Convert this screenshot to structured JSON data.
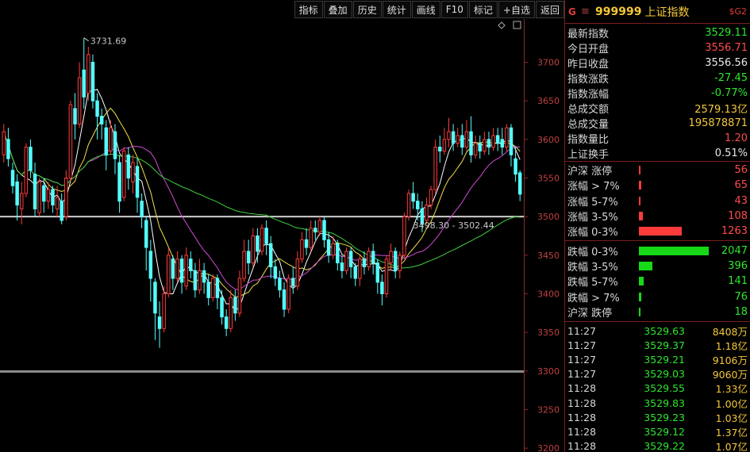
{
  "toolbar": {
    "buttons": [
      "指标",
      "叠加",
      "历史",
      "统计",
      "画线",
      "F10",
      "标记",
      "+自选",
      "返回"
    ]
  },
  "colors": {
    "up": "#ff3b3b",
    "down": "#54ffff",
    "ma5": "#ffffff",
    "ma10": "#f3e04a",
    "ma20": "#d14ad6",
    "ma60": "#3ecf3e",
    "bar_up": "#ff3b3b",
    "bar_down": "#16d816"
  },
  "panel": {
    "logo": "G",
    "menu_icon": "≡",
    "code": "999999",
    "name": "上证指数",
    "tag": "$G2",
    "stats": [
      {
        "label": "最新指数",
        "value": "3529.11",
        "color": "green"
      },
      {
        "label": "今日开盘",
        "value": "3556.71",
        "color": "red"
      },
      {
        "label": "昨日收盘",
        "value": "3556.56",
        "color": "white"
      },
      {
        "label": "指数涨跌",
        "value": "-27.45",
        "color": "green"
      },
      {
        "label": "指数涨幅",
        "value": "-0.77%",
        "color": "green"
      },
      {
        "label": "总成交额",
        "value": "2579.13亿",
        "color": "yellow"
      },
      {
        "label": "总成交量",
        "value": "195878871",
        "color": "yellow"
      },
      {
        "label": "指数量比",
        "value": "1.20",
        "color": "red"
      },
      {
        "label": "上证换手",
        "value": "0.51%",
        "color": "white"
      }
    ],
    "breadth_up": [
      {
        "label": "沪深 涨停",
        "value": "56"
      },
      {
        "label": "涨幅 > 7%",
        "value": "65"
      },
      {
        "label": "涨幅 5-7%",
        "value": "43"
      },
      {
        "label": "涨幅 3-5%",
        "value": "108"
      },
      {
        "label": "涨幅 0-3%",
        "value": "1263"
      }
    ],
    "breadth_down": [
      {
        "label": "跌幅 0-3%",
        "value": "2047"
      },
      {
        "label": "跌幅 3-5%",
        "value": "396"
      },
      {
        "label": "跌幅 5-7%",
        "value": "141"
      },
      {
        "label": "跌幅 > 7%",
        "value": "76"
      },
      {
        "label": "沪深 跌停",
        "value": "18"
      }
    ],
    "ticks": [
      {
        "time": "11:27",
        "price": "3529.63",
        "vol": "8408万"
      },
      {
        "time": "11:27",
        "price": "3529.37",
        "vol": "1.18亿"
      },
      {
        "time": "11:27",
        "price": "3529.21",
        "vol": "9106万"
      },
      {
        "time": "11:27",
        "price": "3529.03",
        "vol": "9060万"
      },
      {
        "time": "11:28",
        "price": "3529.55",
        "vol": "1.33亿"
      },
      {
        "time": "11:28",
        "price": "3529.83",
        "vol": "1.00亿"
      },
      {
        "time": "11:28",
        "price": "3529.23",
        "vol": "1.03亿"
      },
      {
        "time": "11:28",
        "price": "3529.12",
        "vol": "1.37亿"
      },
      {
        "time": "11:28",
        "price": "3529.22",
        "vol": "1.07亿"
      }
    ]
  },
  "chart_data": {
    "type": "candlestick",
    "y_ticks": [
      3200,
      3250,
      3300,
      3350,
      3400,
      3450,
      3500,
      3550,
      3600,
      3650,
      3700
    ],
    "ylim": [
      3195,
      3756
    ],
    "high_label": "3731.69",
    "cursor_label": "3498.30 - 3502.44",
    "cursor_value": 3500,
    "candles": [
      [
        3580,
        3610,
        3570,
        3620
      ],
      [
        3600,
        3575,
        3565,
        3615
      ],
      [
        3560,
        3540,
        3530,
        3570
      ],
      [
        3545,
        3515,
        3495,
        3555
      ],
      [
        3510,
        3530,
        3490,
        3545
      ],
      [
        3530,
        3590,
        3525,
        3595
      ],
      [
        3590,
        3560,
        3550,
        3600
      ],
      [
        3555,
        3510,
        3500,
        3570
      ],
      [
        3505,
        3545,
        3500,
        3550
      ],
      [
        3540,
        3520,
        3505,
        3550
      ],
      [
        3520,
        3535,
        3510,
        3545
      ],
      [
        3535,
        3515,
        3505,
        3540
      ],
      [
        3510,
        3525,
        3500,
        3540
      ],
      [
        3520,
        3495,
        3490,
        3530
      ],
      [
        3500,
        3550,
        3495,
        3560
      ],
      [
        3550,
        3645,
        3545,
        3650
      ],
      [
        3640,
        3620,
        3600,
        3660
      ],
      [
        3620,
        3680,
        3615,
        3700
      ],
      [
        3690,
        3655,
        3640,
        3731.69
      ],
      [
        3660,
        3710,
        3650,
        3720
      ],
      [
        3700,
        3650,
        3640,
        3710
      ],
      [
        3650,
        3630,
        3600,
        3660
      ],
      [
        3630,
        3620,
        3600,
        3640
      ],
      [
        3615,
        3580,
        3560,
        3625
      ],
      [
        3585,
        3615,
        3580,
        3625
      ],
      [
        3610,
        3575,
        3555,
        3620
      ],
      [
        3570,
        3520,
        3505,
        3580
      ],
      [
        3525,
        3585,
        3520,
        3590
      ],
      [
        3580,
        3550,
        3535,
        3590
      ],
      [
        3545,
        3570,
        3530,
        3580
      ],
      [
        3565,
        3525,
        3505,
        3575
      ],
      [
        3520,
        3500,
        3485,
        3530
      ],
      [
        3495,
        3460,
        3430,
        3500
      ],
      [
        3455,
        3420,
        3390,
        3470
      ],
      [
        3415,
        3375,
        3340,
        3420
      ],
      [
        3370,
        3355,
        3330,
        3390
      ],
      [
        3355,
        3400,
        3350,
        3410
      ],
      [
        3400,
        3450,
        3395,
        3460
      ],
      [
        3445,
        3420,
        3405,
        3450
      ],
      [
        3420,
        3445,
        3415,
        3455
      ],
      [
        3445,
        3415,
        3400,
        3450
      ],
      [
        3410,
        3450,
        3405,
        3460
      ],
      [
        3445,
        3430,
        3420,
        3455
      ],
      [
        3430,
        3405,
        3395,
        3440
      ],
      [
        3405,
        3430,
        3400,
        3445
      ],
      [
        3430,
        3415,
        3400,
        3440
      ],
      [
        3415,
        3395,
        3385,
        3425
      ],
      [
        3395,
        3420,
        3390,
        3425
      ],
      [
        3420,
        3395,
        3380,
        3425
      ],
      [
        3395,
        3370,
        3360,
        3405
      ],
      [
        3370,
        3355,
        3345,
        3380
      ],
      [
        3355,
        3395,
        3350,
        3405
      ],
      [
        3395,
        3375,
        3365,
        3405
      ],
      [
        3375,
        3420,
        3370,
        3430
      ],
      [
        3420,
        3455,
        3415,
        3470
      ],
      [
        3455,
        3440,
        3425,
        3470
      ],
      [
        3440,
        3475,
        3435,
        3485
      ],
      [
        3475,
        3455,
        3440,
        3485
      ],
      [
        3455,
        3485,
        3450,
        3490
      ],
      [
        3485,
        3465,
        3450,
        3495
      ],
      [
        3465,
        3435,
        3420,
        3475
      ],
      [
        3435,
        3420,
        3410,
        3445
      ],
      [
        3420,
        3405,
        3395,
        3430
      ],
      [
        3405,
        3380,
        3370,
        3415
      ],
      [
        3380,
        3420,
        3375,
        3425
      ],
      [
        3420,
        3410,
        3400,
        3435
      ],
      [
        3410,
        3445,
        3405,
        3455
      ],
      [
        3445,
        3470,
        3440,
        3480
      ],
      [
        3470,
        3460,
        3450,
        3485
      ],
      [
        3460,
        3485,
        3455,
        3495
      ],
      [
        3485,
        3480,
        3470,
        3495
      ],
      [
        3480,
        3495,
        3475,
        3500
      ],
      [
        3495,
        3470,
        3460,
        3500
      ],
      [
        3470,
        3450,
        3440,
        3480
      ],
      [
        3450,
        3465,
        3445,
        3475
      ],
      [
        3465,
        3440,
        3430,
        3470
      ],
      [
        3440,
        3430,
        3420,
        3450
      ],
      [
        3430,
        3455,
        3425,
        3460
      ],
      [
        3455,
        3435,
        3420,
        3460
      ],
      [
        3435,
        3420,
        3410,
        3440
      ],
      [
        3420,
        3445,
        3410,
        3450
      ],
      [
        3445,
        3435,
        3425,
        3455
      ],
      [
        3435,
        3455,
        3430,
        3460
      ],
      [
        3455,
        3440,
        3425,
        3465
      ],
      [
        3440,
        3415,
        3400,
        3445
      ],
      [
        3415,
        3400,
        3385,
        3425
      ],
      [
        3400,
        3445,
        3395,
        3450
      ],
      [
        3440,
        3455,
        3430,
        3465
      ],
      [
        3455,
        3430,
        3420,
        3460
      ],
      [
        3430,
        3450,
        3420,
        3455
      ],
      [
        3450,
        3500,
        3445,
        3505
      ],
      [
        3500,
        3530,
        3495,
        3535
      ],
      [
        3530,
        3520,
        3510,
        3545
      ],
      [
        3520,
        3510,
        3495,
        3530
      ],
      [
        3510,
        3490,
        3480,
        3520
      ],
      [
        3495,
        3515,
        3490,
        3525
      ],
      [
        3515,
        3535,
        3510,
        3540
      ],
      [
        3535,
        3590,
        3530,
        3600
      ],
      [
        3590,
        3585,
        3570,
        3605
      ],
      [
        3585,
        3600,
        3580,
        3615
      ],
      [
        3600,
        3610,
        3590,
        3628
      ],
      [
        3610,
        3595,
        3585,
        3620
      ],
      [
        3595,
        3605,
        3590,
        3615
      ],
      [
        3605,
        3590,
        3580,
        3620
      ],
      [
        3590,
        3610,
        3585,
        3625
      ],
      [
        3610,
        3580,
        3570,
        3630
      ],
      [
        3580,
        3595,
        3575,
        3605
      ],
      [
        3595,
        3585,
        3575,
        3605
      ],
      [
        3585,
        3600,
        3580,
        3610
      ],
      [
        3600,
        3590,
        3580,
        3610
      ],
      [
        3590,
        3605,
        3585,
        3615
      ],
      [
        3605,
        3595,
        3585,
        3615
      ],
      [
        3600,
        3590,
        3580,
        3615
      ],
      [
        3590,
        3615,
        3585,
        3620
      ],
      [
        3615,
        3580,
        3565,
        3620
      ],
      [
        3575,
        3555,
        3545,
        3590
      ],
      [
        3556.71,
        3529.11,
        3520,
        3560
      ]
    ]
  }
}
